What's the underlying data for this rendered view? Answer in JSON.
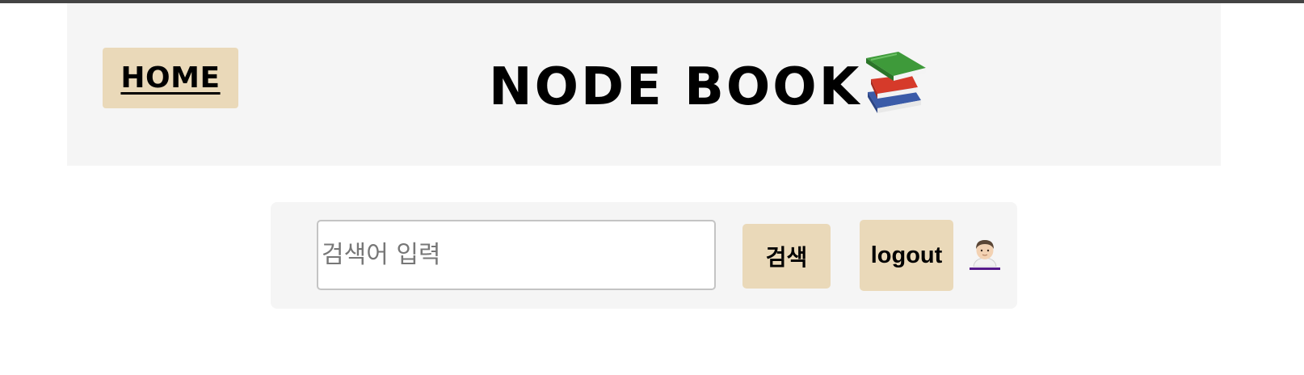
{
  "header": {
    "home_label": "HOME",
    "title": "NODE BOOK",
    "title_icon": "books-icon"
  },
  "search": {
    "placeholder": "검색어 입력",
    "value": "",
    "button_label": "검색"
  },
  "account": {
    "logout_label": "logout",
    "user_icon": "person-face-icon"
  },
  "colors": {
    "button_bg": "#ead9b9",
    "panel_bg": "#f5f5f5",
    "top_border": "#444444",
    "link_underline": "#551a8b"
  }
}
